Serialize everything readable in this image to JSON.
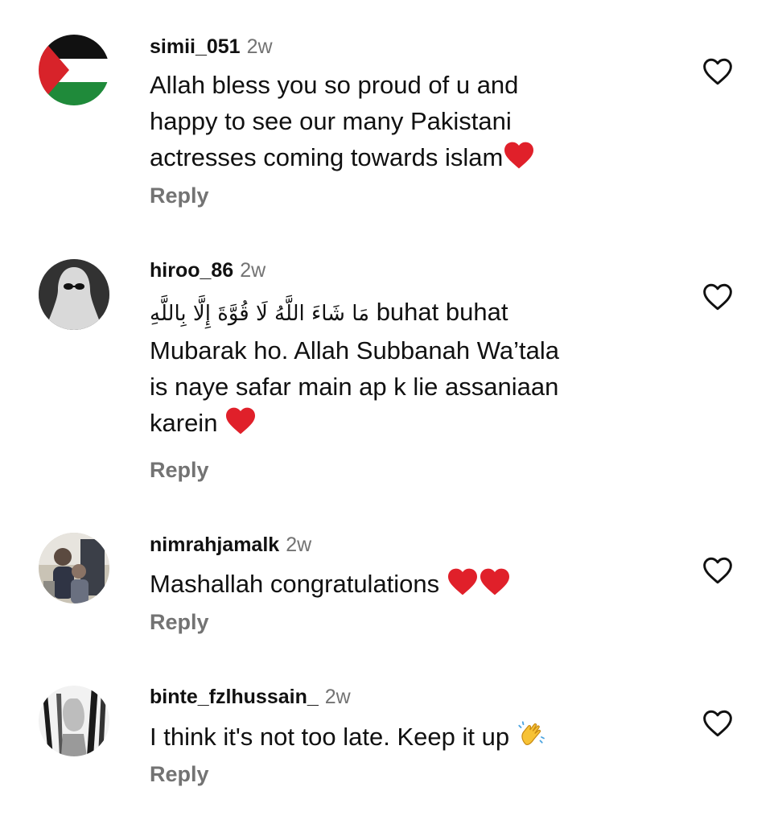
{
  "comments": [
    {
      "username": "simii_051",
      "time": "2w",
      "text_lines": [
        "Allah bless you so proud of u and",
        "happy to see our many Pakistani",
        "actresses coming towards islam"
      ],
      "trailing_emoji": "heart-emoji",
      "reply_label": "Reply",
      "avatar": "palestine-flag-avatar"
    },
    {
      "username": "hiroo_86",
      "time": "2w",
      "arabic_text": "مَا شَاءَ اللَّهُ لَا قُوَّةَ إِلَّا بِاللَّهِ",
      "text_first_line_rest": "buhat buhat",
      "text_lines": [
        "Mubarak ho. Allah Subbanah Wa’tala",
        "is naye safar main ap k lie assaniaan",
        "karein"
      ],
      "trailing_emoji": "heart-emoji",
      "reply_label": "Reply",
      "avatar": "veiled-person-avatar"
    },
    {
      "username": "nimrahjamalk",
      "time": "2w",
      "text_lines": [
        "Mashallah congratulations"
      ],
      "trailing_emoji": "two-hearts-emoji",
      "reply_label": "Reply",
      "avatar": "photo-avatar"
    },
    {
      "username": "binte_fzlhussain_",
      "time": "2w",
      "text_lines": [
        "I think it's not too late. Keep it up"
      ],
      "trailing_emoji": "clapping-hands-emoji",
      "reply_label": "Reply",
      "avatar": "sketch-avatar"
    }
  ],
  "colors": {
    "text": "#111111",
    "muted": "#737373",
    "heart_red": "#e0202a",
    "flag_black": "#111111",
    "flag_green": "#1f8a3a",
    "flag_red": "#d8232a"
  },
  "icons": {
    "like": "heart-outline-icon"
  }
}
